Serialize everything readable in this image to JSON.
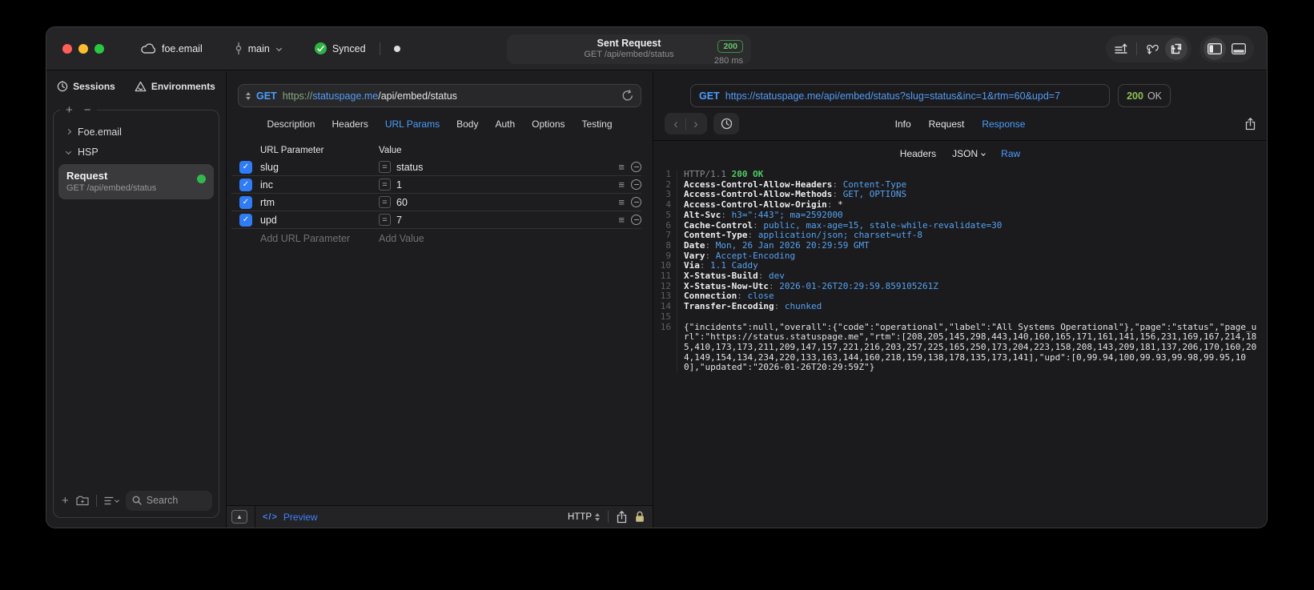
{
  "titlebar": {
    "project": "foe.email",
    "branch": "main",
    "sync_label": "Synced",
    "title": "Sent Request",
    "subtitle": "GET /api/embed/status",
    "status_code": "200",
    "duration": "280 ms"
  },
  "sidebar": {
    "tab_sessions": "Sessions",
    "tab_environments": "Environments",
    "tree": {
      "group1": "Foe.email",
      "group2": "HSP"
    },
    "request": {
      "title": "Request",
      "subtitle": "GET /api/embed/status"
    },
    "search_placeholder": "Search"
  },
  "request_panel": {
    "method": "GET",
    "url_scheme": "https://",
    "url_host": "statuspage.me",
    "url_path": "/api/embed/status",
    "tabs": [
      "Description",
      "Headers",
      "URL Params",
      "Body",
      "Auth",
      "Options",
      "Testing"
    ],
    "active_tab": "URL Params",
    "param_table": {
      "col_name": "URL Parameter",
      "col_value": "Value",
      "rows": [
        {
          "name": "slug",
          "value": "status",
          "checked": true
        },
        {
          "name": "inc",
          "value": "1",
          "checked": true
        },
        {
          "name": "rtm",
          "value": "60",
          "checked": true
        },
        {
          "name": "upd",
          "value": "7",
          "checked": true
        }
      ],
      "add_name": "Add URL Parameter",
      "add_value": "Add Value"
    },
    "footer": {
      "code_glyph": "</>",
      "preview": "Preview",
      "protocol": "HTTP"
    }
  },
  "response_panel": {
    "method": "GET",
    "url": "https://statuspage.me/api/embed/status?slug=status&inc=1&rtm=60&upd=7",
    "status_code": "200",
    "status_text": "OK",
    "tabs": [
      "Info",
      "Request",
      "Response"
    ],
    "active_tab": "Response",
    "subtabs": [
      "Headers",
      "JSON",
      "Raw"
    ],
    "active_subtab": "Raw",
    "lines": [
      {
        "num": "1",
        "segs": [
          {
            "c": "muted",
            "t": "HTTP/1.1 "
          },
          {
            "c": "green",
            "t": "200 OK"
          }
        ]
      },
      {
        "num": "2",
        "segs": [
          {
            "c": "name",
            "t": "Access-Control-Allow-Headers"
          },
          {
            "c": "muted",
            "t": ": "
          },
          {
            "c": "blue",
            "t": "Content-Type"
          }
        ]
      },
      {
        "num": "3",
        "segs": [
          {
            "c": "name",
            "t": "Access-Control-Allow-Methods"
          },
          {
            "c": "muted",
            "t": ": "
          },
          {
            "c": "blue",
            "t": "GET, OPTIONS"
          }
        ]
      },
      {
        "num": "4",
        "segs": [
          {
            "c": "name",
            "t": "Access-Control-Allow-Origin"
          },
          {
            "c": "muted",
            "t": ": "
          },
          {
            "c": "plain",
            "t": "*"
          }
        ]
      },
      {
        "num": "5",
        "segs": [
          {
            "c": "name",
            "t": "Alt-Svc"
          },
          {
            "c": "muted",
            "t": ": "
          },
          {
            "c": "blue",
            "t": "h3=\":443\"; ma=2592000"
          }
        ]
      },
      {
        "num": "6",
        "segs": [
          {
            "c": "name",
            "t": "Cache-Control"
          },
          {
            "c": "muted",
            "t": ": "
          },
          {
            "c": "blue",
            "t": "public, max-age=15, stale-while-revalidate=30"
          }
        ]
      },
      {
        "num": "7",
        "segs": [
          {
            "c": "name",
            "t": "Content-Type"
          },
          {
            "c": "muted",
            "t": ": "
          },
          {
            "c": "blue",
            "t": "application/json; charset=utf-8"
          }
        ]
      },
      {
        "num": "8",
        "segs": [
          {
            "c": "name",
            "t": "Date"
          },
          {
            "c": "muted",
            "t": ": "
          },
          {
            "c": "blue",
            "t": "Mon, 26 Jan 2026 20:29:59 GMT"
          }
        ]
      },
      {
        "num": "9",
        "segs": [
          {
            "c": "name",
            "t": "Vary"
          },
          {
            "c": "muted",
            "t": ": "
          },
          {
            "c": "blue",
            "t": "Accept-Encoding"
          }
        ]
      },
      {
        "num": "10",
        "segs": [
          {
            "c": "name",
            "t": "Via"
          },
          {
            "c": "muted",
            "t": ": "
          },
          {
            "c": "blue",
            "t": "1.1 Caddy"
          }
        ]
      },
      {
        "num": "11",
        "segs": [
          {
            "c": "name",
            "t": "X-Status-Build"
          },
          {
            "c": "muted",
            "t": ": "
          },
          {
            "c": "blue",
            "t": "dev"
          }
        ]
      },
      {
        "num": "12",
        "segs": [
          {
            "c": "name",
            "t": "X-Status-Now-Utc"
          },
          {
            "c": "muted",
            "t": ": "
          },
          {
            "c": "blue",
            "t": "2026-01-26T20:29:59.859105261Z"
          }
        ]
      },
      {
        "num": "13",
        "segs": [
          {
            "c": "name",
            "t": "Connection"
          },
          {
            "c": "muted",
            "t": ": "
          },
          {
            "c": "blue",
            "t": "close"
          }
        ]
      },
      {
        "num": "14",
        "segs": [
          {
            "c": "name",
            "t": "Transfer-Encoding"
          },
          {
            "c": "muted",
            "t": ": "
          },
          {
            "c": "blue",
            "t": "chunked"
          }
        ]
      },
      {
        "num": "15",
        "segs": []
      },
      {
        "num": "16",
        "segs": [
          {
            "c": "plain",
            "t": "{\"incidents\":null,\"overall\":{\"code\":\"operational\",\"label\":\"All Systems Operational\"},\"page\":\"status\",\"page_url\":\"https://status.statuspage.me\",\"rtm\":[208,205,145,298,443,140,160,165,171,161,141,156,231,169,167,214,185,410,173,173,211,209,147,157,221,216,203,257,225,165,250,173,204,223,158,208,143,209,181,137,206,170,160,204,149,154,134,234,220,133,163,144,160,218,159,138,178,135,173,141],\"upd\":[0,99.94,100,99.93,99.98,99.95,100],\"updated\":\"2026-01-26T20:29:59Z\"}"
          }
        ]
      }
    ]
  },
  "colors": {
    "accent": "#4a9eff",
    "success_green": "#32d74b",
    "checkbox_blue": "#2f7cf6",
    "badge_green": "#64c864"
  }
}
